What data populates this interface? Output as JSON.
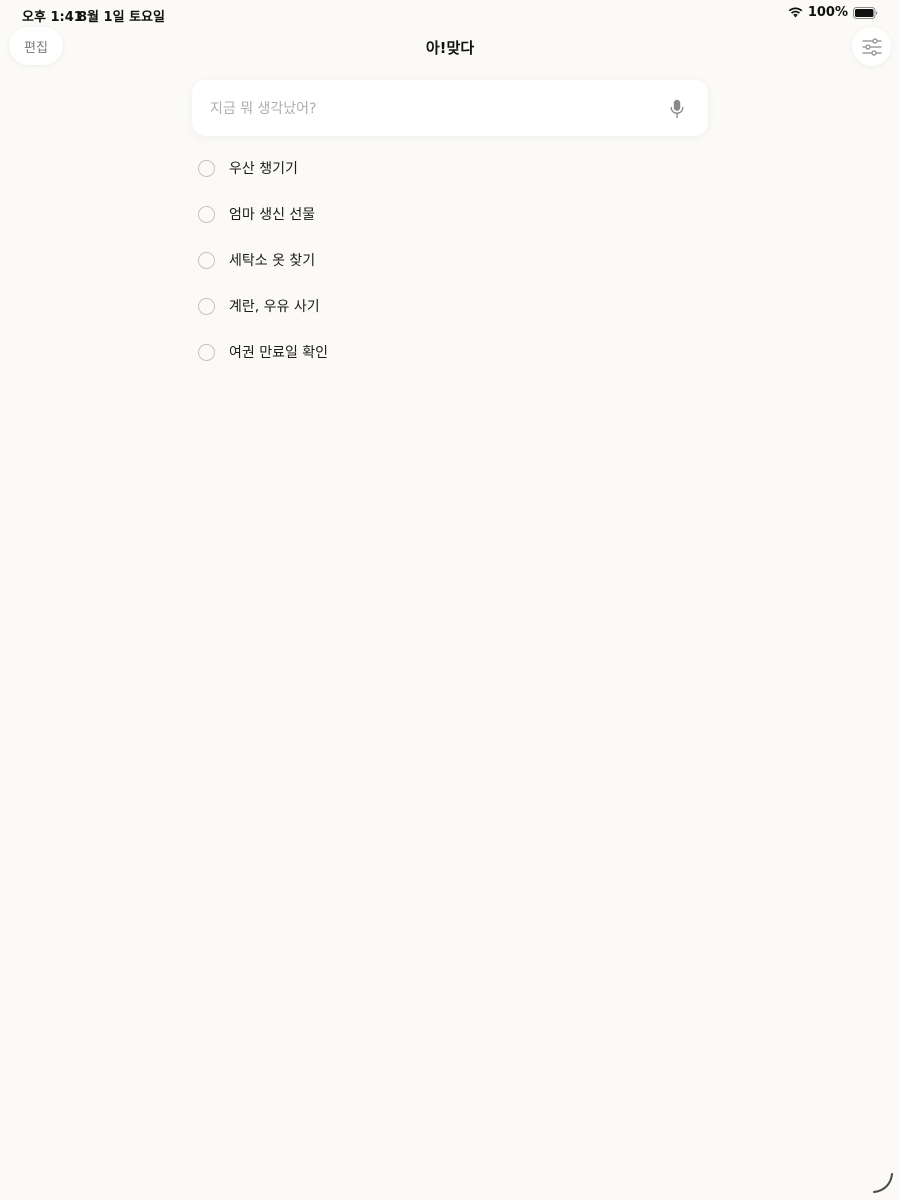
{
  "status_bar": {
    "time": "오후 1:41",
    "date": "8월 1일 토요일",
    "battery_percent": "100%"
  },
  "header": {
    "edit_label": "편집",
    "title": "아!맞다",
    "settings_icon": "sliders-icon"
  },
  "search": {
    "placeholder": "지금 뭐 생각났어?",
    "value": "",
    "mic_icon": "microphone-icon"
  },
  "todos": [
    {
      "label": "우산 챙기기",
      "done": false
    },
    {
      "label": "엄마 생신 선물",
      "done": false
    },
    {
      "label": "세탁소 옷 찾기",
      "done": false
    },
    {
      "label": "계란, 우유 사기",
      "done": false
    },
    {
      "label": "여권 만료일 확인",
      "done": false
    }
  ],
  "colors": {
    "background": "#fbfaf6",
    "card": "#ffffff",
    "text": "#1c1c1e",
    "muted": "#aeaeae",
    "checkbox_border": "#c4c4c4"
  }
}
